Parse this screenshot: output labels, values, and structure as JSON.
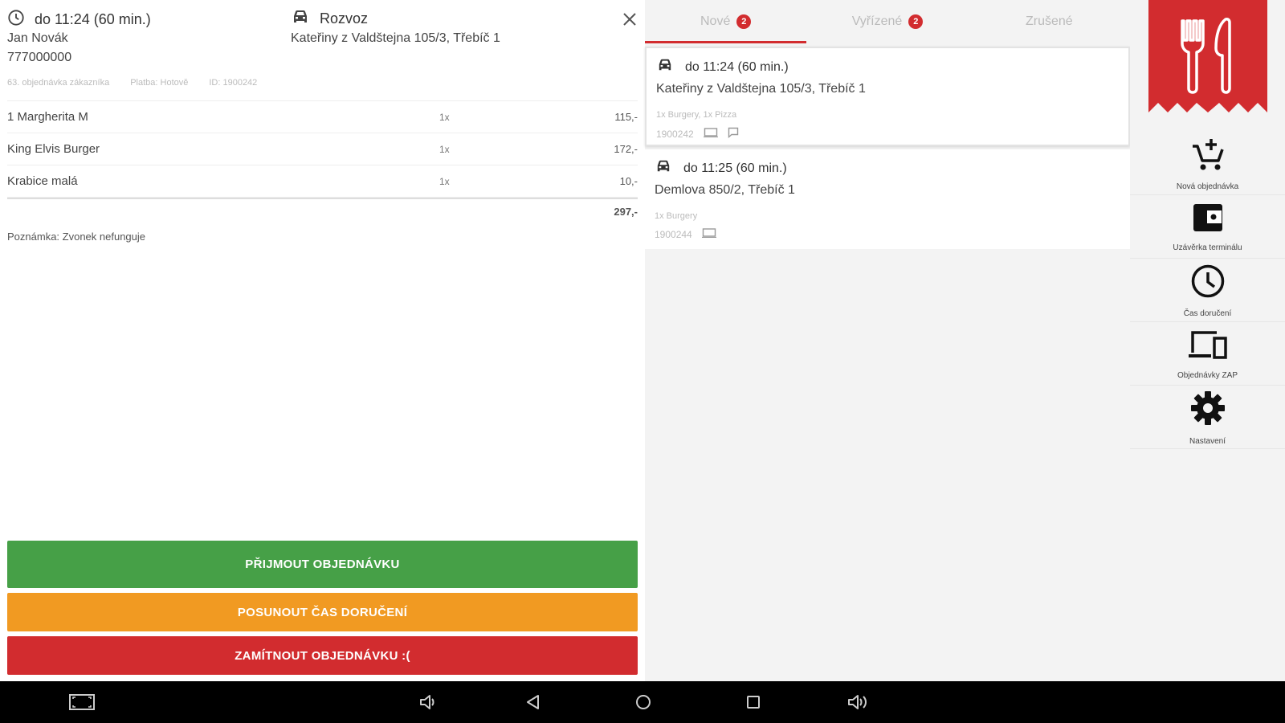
{
  "detail": {
    "time": "do 11:24 (60 min.)",
    "customer_name": "Jan Novák",
    "phone": "777000000",
    "delivery_type": "Rozvoz",
    "address": "Kateřiny z Valdštejna 105/3, Třebíč 1",
    "meta": [
      "63. objednávka zákazníka",
      "Platba: Hotově",
      "ID: 1900242"
    ],
    "items": [
      {
        "name": "1 Margherita M",
        "qty": "1x",
        "price": "115,-"
      },
      {
        "name": "King Elvis Burger",
        "qty": "1x",
        "price": "172,-"
      },
      {
        "name": "Krabice malá",
        "qty": "1x",
        "price": "10,-"
      }
    ],
    "total": "297,-",
    "note": "Poznámka: Zvonek nefunguje",
    "buttons": {
      "accept": "PŘIJMOUT OBJEDNÁVKU",
      "postpone": "POSUNOUT ČAS DORUČENÍ",
      "reject": "ZAMÍTNOUT OBJEDNÁVKU :("
    }
  },
  "list": {
    "tabs": [
      {
        "label": "Nové",
        "badge": "2"
      },
      {
        "label": "Vyřízené",
        "badge": "2"
      },
      {
        "label": "Zrušené",
        "badge": ""
      }
    ],
    "orders": [
      {
        "time": "do 11:24 (60 min.)",
        "address": "Kateřiny z Valdštejna 105/3, Třebíč 1",
        "summary": "1x Burgery, 1x Pizza",
        "id": "1900242"
      },
      {
        "time": "do 11:25 (60 min.)",
        "address": "Demlova 850/2, Třebíč 1",
        "summary": "1x Burgery",
        "id": "1900244"
      }
    ]
  },
  "sidebar": {
    "items": [
      {
        "label": "Nová objednávka",
        "icon": "cart-add-icon"
      },
      {
        "label": "Uzávěrka terminálu",
        "icon": "wallet-icon"
      },
      {
        "label": "Čas doručení",
        "icon": "clock-icon"
      },
      {
        "label": "Objednávky ZAP",
        "icon": "devices-icon"
      },
      {
        "label": "Nastavení",
        "icon": "gear-icon"
      }
    ]
  },
  "colors": {
    "accent_red": "#d22c2f",
    "accept_green": "#46a047",
    "postpone_orange": "#f19a22",
    "panel_gray": "#f3f3f3"
  }
}
